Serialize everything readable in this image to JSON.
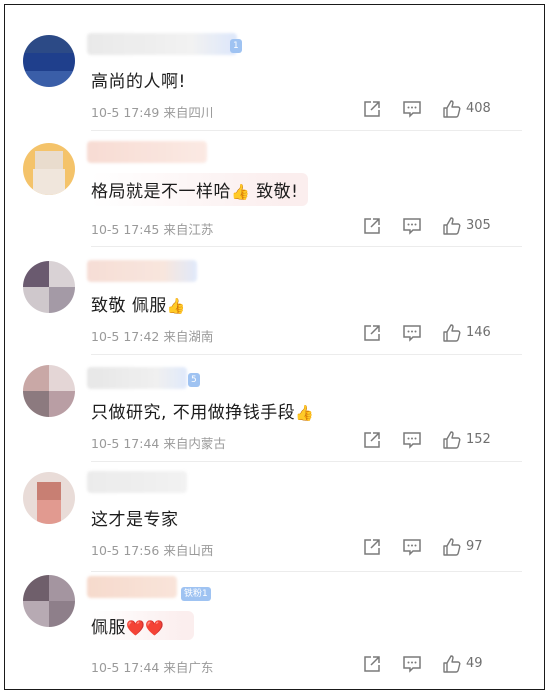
{
  "colors": {
    "text": "#1d1d1d",
    "meta": "#9a9a9a",
    "divider": "#ececec",
    "badge": "#9fc3f2"
  },
  "icons": {
    "share": "share-icon",
    "reply": "reply-icon",
    "like": "thumbs-up-icon"
  },
  "comments": [
    {
      "text": "高尚的人啊!",
      "emoji": "",
      "time": "10-5 17:49",
      "location": "来自四川",
      "likes": "408",
      "badge": "1"
    },
    {
      "text": "格局就是不一样哈",
      "emoji": "👍",
      "text_after": " 致敬!",
      "time": "10-5 17:45",
      "location": "来自江苏",
      "likes": "305",
      "badge": ""
    },
    {
      "text": "致敬 佩服",
      "emoji": "👍",
      "time": "10-5 17:42",
      "location": "来自湖南",
      "likes": "146",
      "badge": ""
    },
    {
      "text": "只做研究, 不用做挣钱手段",
      "emoji": "👍",
      "time": "10-5 17:44",
      "location": "来自内蒙古",
      "likes": "152",
      "badge": "5"
    },
    {
      "text": "这才是专家",
      "emoji": "",
      "time": "10-5 17:56",
      "location": "来自山西",
      "likes": "97",
      "badge": ""
    },
    {
      "text": "佩服",
      "emoji": "❤️❤️",
      "time": "10-5 17:44",
      "location": "来自广东",
      "likes": "49",
      "badge": "铁粉1"
    }
  ]
}
